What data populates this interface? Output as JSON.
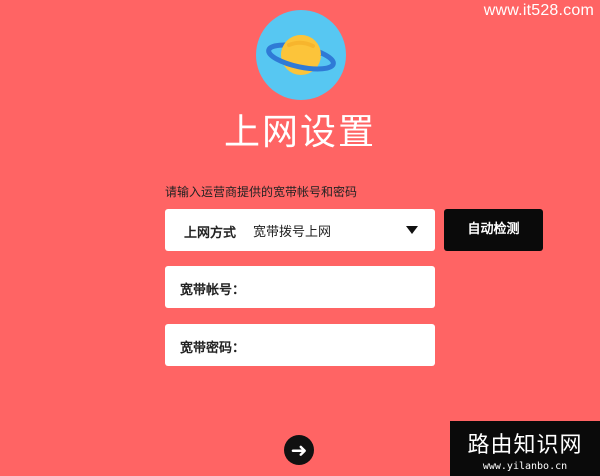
{
  "watermark_top": "www.it528.com",
  "page": {
    "title": "上网设置",
    "hint": "请输入运营商提供的宽带帐号和密码"
  },
  "form": {
    "method_label": "上网方式",
    "method_value": "宽带拨号上网",
    "detect_label": "自动检测",
    "account_label": "宽带帐号：",
    "account_value": "",
    "password_label": "宽带密码：",
    "password_value": ""
  },
  "next_button": {
    "icon": "arrow-right-icon"
  },
  "watermark_bottom": {
    "title": "路由知识网",
    "url": "www.yilanbo.cn"
  },
  "colors": {
    "background": "#ff6464",
    "logo_circle": "#57c7f2",
    "planet": "#fcc43a",
    "ring": "#2f7ad6",
    "button_dark": "#0a0a0a"
  }
}
